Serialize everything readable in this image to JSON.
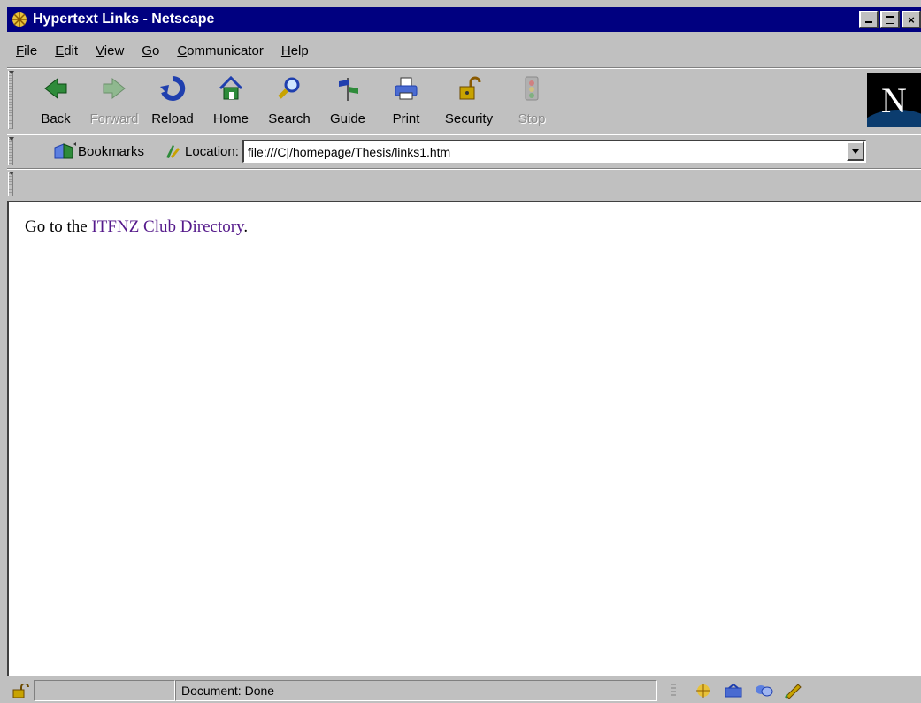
{
  "window": {
    "title": "Hypertext Links - Netscape",
    "controls": [
      "_",
      "□",
      "×"
    ]
  },
  "menu": [
    {
      "underline": "F",
      "rest": "ile"
    },
    {
      "underline": "E",
      "rest": "dit"
    },
    {
      "underline": "V",
      "rest": "iew"
    },
    {
      "underline": "G",
      "rest": "o"
    },
    {
      "underline": "C",
      "rest": "ommunicator"
    },
    {
      "underline": "H",
      "rest": "elp"
    }
  ],
  "toolbar": {
    "back": "Back",
    "forward": "Forward",
    "reload": "Reload",
    "home": "Home",
    "search": "Search",
    "guide": "Guide",
    "print": "Print",
    "security": "Security",
    "stop": "Stop"
  },
  "logo": "N",
  "location": {
    "bookmarks_label": "Bookmarks",
    "label": "Location:",
    "url": "file:///C|/homepage/Thesis/links1.htm"
  },
  "page": {
    "prefix": "Go to the ",
    "link_text": "ITFNZ Club Directory",
    "suffix": "."
  },
  "status": {
    "text": "Document: Done"
  },
  "colors": {
    "titlebar": "#000080",
    "chrome": "#c0c0c0",
    "link_visited": "#551a8b"
  }
}
